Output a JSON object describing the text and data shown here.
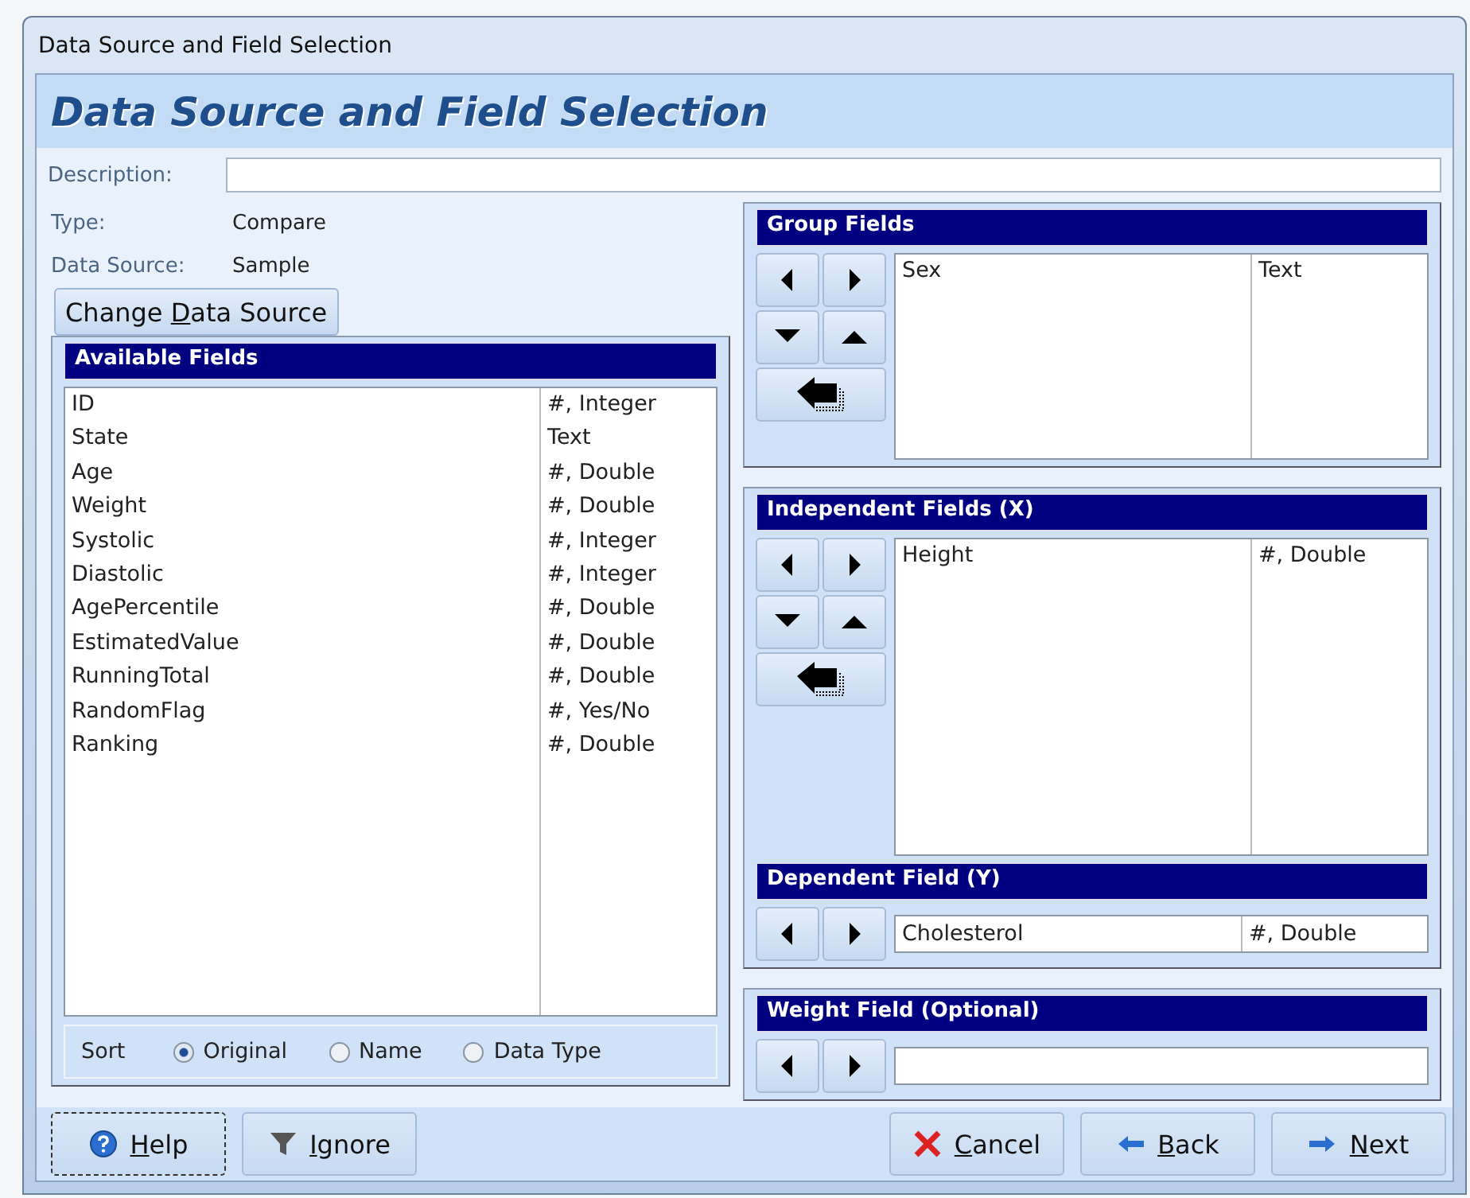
{
  "window": {
    "title": "Data Source and Field Selection"
  },
  "header": {
    "title": "Data Source and Field Selection"
  },
  "description": {
    "label": "Description:"
  },
  "type": {
    "label": "Type:",
    "value": "Compare"
  },
  "data_source": {
    "label": "Data Source:",
    "value": "Sample"
  },
  "change_button": {
    "label": [
      {
        "text": "Change ",
        "underlined": false
      },
      {
        "text": "D",
        "underlined": true
      },
      {
        "text": "ata Source",
        "underlined": false
      }
    ]
  },
  "available_fields": {
    "title": "Available Fields",
    "rows": [
      {
        "name": "ID",
        "type": "#, Integer"
      },
      {
        "name": "State",
        "type": "Text"
      },
      {
        "name": "Age",
        "type": "#, Double"
      },
      {
        "name": "Weight",
        "type": "#, Double"
      },
      {
        "name": "Systolic",
        "type": "#, Integer"
      },
      {
        "name": "Diastolic",
        "type": "#, Integer"
      },
      {
        "name": "AgePercentile",
        "type": "#, Double"
      },
      {
        "name": "EstimatedValue",
        "type": "#, Double"
      },
      {
        "name": "RunningTotal",
        "type": "#, Double"
      },
      {
        "name": "RandomFlag",
        "type": "#, Yes/No"
      },
      {
        "name": "Ranking",
        "type": "#, Double"
      }
    ],
    "sort": {
      "label": "Sort",
      "options": [
        {
          "label": "Original",
          "selected": true
        },
        {
          "label": "Name",
          "selected": false
        },
        {
          "label": "Data Type",
          "selected": false
        }
      ]
    }
  },
  "group_fields": {
    "title": "Group Fields",
    "rows": [
      {
        "name": "Sex",
        "type": "Text"
      }
    ]
  },
  "independent_fields": {
    "title": "Independent Fields (X)",
    "rows": [
      {
        "name": "Height",
        "type": "#, Double"
      }
    ]
  },
  "dependent_field": {
    "title": "Dependent Field (Y)",
    "name": "Cholesterol",
    "type": "#, Double"
  },
  "weight_field": {
    "title": "Weight Field (Optional)"
  },
  "buttons": [
    {
      "kind": "help",
      "label": [
        {
          "text": "H",
          "underlined": true
        },
        {
          "text": "elp",
          "underlined": false
        }
      ],
      "focused": true
    },
    {
      "kind": "filter",
      "label": [
        {
          "text": "I",
          "underlined": true
        },
        {
          "text": "gnore",
          "underlined": false
        }
      ],
      "focused": false
    },
    {
      "kind": "cancel",
      "label": [
        {
          "text": "C",
          "underlined": true
        },
        {
          "text": "ancel",
          "underlined": false
        }
      ],
      "focused": false
    },
    {
      "kind": "back",
      "label": [
        {
          "text": "B",
          "underlined": true
        },
        {
          "text": "ack",
          "underlined": false
        }
      ],
      "focused": false
    },
    {
      "kind": "next",
      "label": [
        {
          "text": "N",
          "underlined": true
        },
        {
          "text": "ext",
          "underlined": false
        }
      ],
      "focused": false
    }
  ]
}
